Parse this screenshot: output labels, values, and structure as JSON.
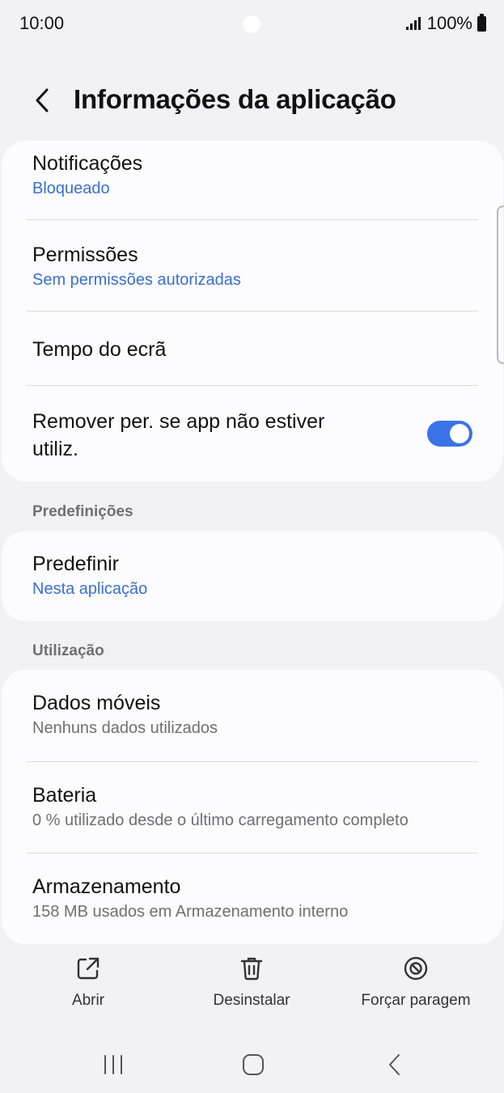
{
  "status_bar": {
    "time": "10:00",
    "battery": "100%",
    "icons": [
      "camera-dot",
      "signal-icon",
      "battery-icon"
    ]
  },
  "header": {
    "title": "Informações da aplicação",
    "back_icon": "chevron-left-icon"
  },
  "card1": {
    "notifications": {
      "title": "Notificações",
      "subtitle": "Bloqueado"
    },
    "permissions": {
      "title": "Permissões",
      "subtitle": "Sem permissões autorizadas"
    },
    "screen_time": {
      "title": "Tempo do ecrã"
    },
    "remove_permissions": {
      "title_line1": "Remover per. se app não estiver",
      "title_line2": "utiliz.",
      "toggle_on": true
    }
  },
  "section_defaults": {
    "label": "Predefinições"
  },
  "card2": {
    "set_default": {
      "title": "Predefinir",
      "subtitle": "Nesta aplicação"
    }
  },
  "section_usage": {
    "label": "Utilização"
  },
  "card3": {
    "mobile_data": {
      "title": "Dados móveis",
      "subtitle": "Nenhuns dados utilizados"
    },
    "battery": {
      "title": "Bateria",
      "subtitle": "0 % utilizado desde o último carregamento completo"
    },
    "storage": {
      "title": "Armazenamento",
      "subtitle": "158 MB usados em Armazenamento interno"
    }
  },
  "bottom_actions": {
    "open": {
      "label": "Abrir",
      "icon": "open-external-icon"
    },
    "uninstall": {
      "label": "Desinstalar",
      "icon": "trash-icon"
    },
    "force_stop": {
      "label": "Forçar paragem",
      "icon": "block-icon"
    }
  },
  "nav_bar": {
    "icons": [
      "recents-icon",
      "home-icon",
      "back-icon"
    ]
  },
  "colors": {
    "background": "#f2f2f6",
    "card": "#fcfcfe",
    "accent_blue": "#3a6fd0",
    "toggle_on": "#3a73e8",
    "secondary_text": "#6f6f74"
  }
}
